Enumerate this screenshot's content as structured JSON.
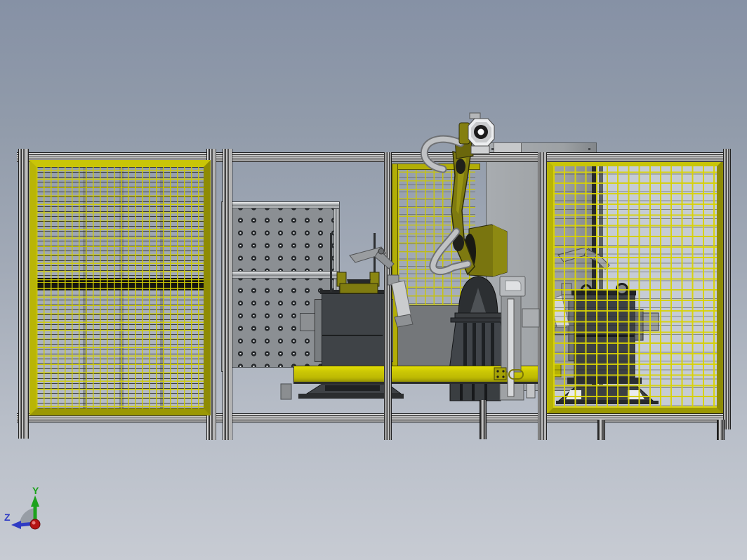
{
  "viewport": {
    "app_type": "cad-3d-viewport",
    "scene_description": "Robotic welding cell: yellow safety fence panels, perforated fixture tables, floor-mounted articulated robot with wire feeder, positioner machines, front elevation view",
    "background_top_color": "#8691a5",
    "background_bottom_color": "#c7cbd3"
  },
  "triad": {
    "y_label": "Y",
    "z_label": "Z",
    "y_axis_color": "#1ca21c",
    "z_axis_color": "#2f3bc4",
    "origin_color": "#b51414",
    "arc_color": "#8f959d"
  },
  "palette": {
    "safety_fence_frame_yellow": "#b5b106",
    "mesh_wire_yellow": "#d6d204",
    "floor_beam_yellow": "#cdc904",
    "robot_arm_olive": "#7e7a10",
    "machine_dark_gray": "#3f4347",
    "aluminum_extrusion_gray": "#b5b5b5",
    "cabinet_panel_gray": "#9da1a4",
    "cell_backwall_light": "#c6ccd5"
  }
}
